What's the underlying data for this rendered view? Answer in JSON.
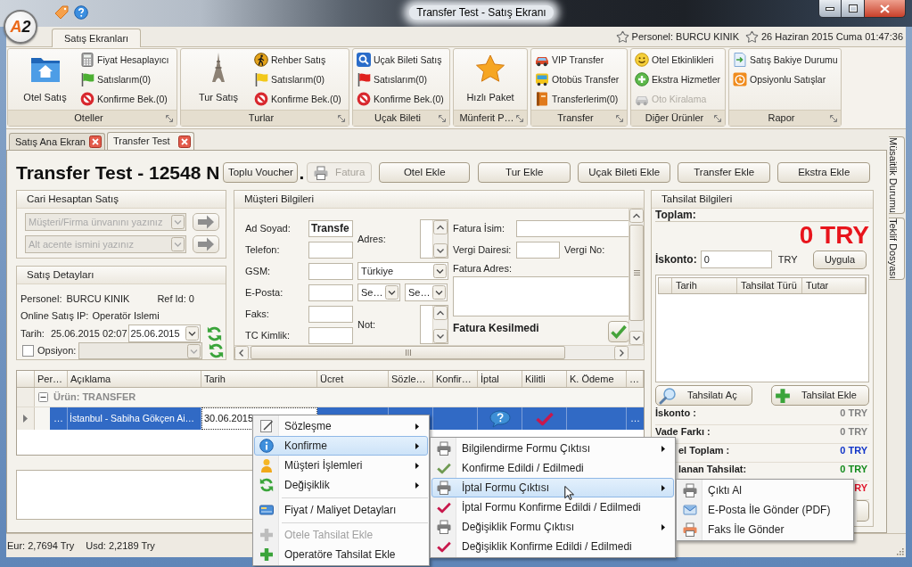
{
  "window": {
    "title": "Transfer Test - Satış Ekranı",
    "logo": "A2"
  },
  "ribbon": {
    "tabs": [
      {
        "label": "Satış Ekranları",
        "selected": true
      }
    ],
    "info": [
      {
        "text": "Personel: BURCU KINIK"
      },
      {
        "text": "26 Haziran 2015 Cuma 01:47:36"
      }
    ],
    "groups": [
      {
        "title": "Oteller",
        "large_button": "Otel Satış",
        "items": [
          {
            "label": "Fiyat Hesaplayıcı",
            "disabled": false
          },
          {
            "label": "Satıslarım(0)",
            "disabled": false
          },
          {
            "label": "Konfirme Bek.(0)",
            "disabled": false
          }
        ]
      },
      {
        "title": "Turlar",
        "large_button": "Tur Satış",
        "items": [
          {
            "label": "Rehber Satış",
            "disabled": false
          },
          {
            "label": "Satıslarım(0)",
            "disabled": false
          },
          {
            "label": "Konfirme Bek.(0)",
            "disabled": false
          }
        ]
      },
      {
        "title": "Uçak Bileti",
        "items": [
          {
            "label": "Uçak Bileti Satış",
            "disabled": false
          },
          {
            "label": "Satıslarım(0)",
            "disabled": false
          },
          {
            "label": "Konfirme Bek.(0)",
            "disabled": false
          }
        ]
      },
      {
        "title": "Münferit P…",
        "large_button": "Hızlı Paket"
      },
      {
        "title": "Transfer",
        "items": [
          {
            "label": "VIP Transfer",
            "disabled": false
          },
          {
            "label": "Otobüs Transfer",
            "disabled": false
          },
          {
            "label": "Transferlerim(0)",
            "disabled": false
          }
        ]
      },
      {
        "title": "Diğer Ürünler",
        "items": [
          {
            "label": "Otel Etkinlikleri",
            "disabled": false
          },
          {
            "label": "Ekstra Hizmetler",
            "disabled": false
          },
          {
            "label": "Oto Kiralama",
            "disabled": true
          }
        ]
      },
      {
        "title": "Rapor",
        "items": [
          {
            "label": "Satış Bakiye Durumu",
            "disabled": false
          },
          {
            "label": "Opsiyonlu Satışlar",
            "disabled": false
          }
        ]
      }
    ]
  },
  "document_tabs": [
    {
      "label": "Satış Ana Ekran",
      "selected": false
    },
    {
      "label": "Transfer Test",
      "selected": true
    }
  ],
  "side_tabs": [
    {
      "label": "Müsaitlik Durumu"
    },
    {
      "label": "Teklif Dosyası"
    }
  ],
  "header": {
    "title": "Transfer Test - 12548 N",
    "title_tail": ".",
    "buttons": [
      {
        "label": "Toplu Voucher",
        "disabled": false
      },
      {
        "label": "Fatura",
        "disabled": true
      },
      {
        "label": "Otel Ekle",
        "disabled": false
      },
      {
        "label": "Tur Ekle",
        "disabled": false
      },
      {
        "label": "Uçak Bileti Ekle",
        "disabled": false
      },
      {
        "label": "Transfer Ekle",
        "disabled": false
      },
      {
        "label": "Ekstra Ekle",
        "disabled": false
      }
    ]
  },
  "account_sale": {
    "title": "Cari Hesaptan Satış",
    "fields": [
      {
        "placeholder": "Müşteri/Firma ünvanını yazınız",
        "disabled": true
      },
      {
        "placeholder": "Alt acente ismini yazınız",
        "disabled": true
      }
    ]
  },
  "sale_details": {
    "title": "Satış Detayları",
    "staff_label": "Personel:",
    "staff": "BURCU KINIK",
    "ref_id": "Ref Id: 0",
    "ip_label": "Online Satış IP:",
    "ip": "Operatör Islemi",
    "date_label": "Tarih:",
    "date_time": "25.06.2015 02:07",
    "date_value": "25.06.2015",
    "option": {
      "label": "Opsiyon:",
      "checked": false,
      "select_disabled": true
    }
  },
  "customer": {
    "title": "Müşteri Bilgileri",
    "fields": [
      {
        "label": "Ad Soyad:",
        "value": "Transfe"
      },
      {
        "label": "Telefon:"
      },
      {
        "label": "GSM:"
      },
      {
        "label": "E-Posta:"
      },
      {
        "label": "Faks:"
      },
      {
        "label": "TC Kimlik:"
      }
    ],
    "address_label": "Adres:",
    "country": "Türkiye",
    "email_selects": [
      "Se…",
      "Se…"
    ],
    "note_label": "Not:",
    "invoice_name_label": "Fatura İsim:",
    "tax_office_label": "Vergi Dairesi:",
    "tax_no_label": "Vergi No:",
    "invoice_address_label": "Fatura Adres:",
    "invoice_status": "Fatura Kesilmedi"
  },
  "orders": {
    "columns": [
      "Per…",
      "Açıklama",
      "Tarih",
      "Ücret",
      "Sözle…",
      "Konfir…",
      "İptal",
      "Kilitli",
      "K. Ödeme",
      "…"
    ],
    "group": {
      "label": "Ürün: TRANSFER",
      "expanded": true
    },
    "rows": [
      {
        "selected": true,
        "per": "…",
        "description": "İstanbul - Sabiha Gökçen Ai…",
        "date": "30.06.2015",
        "more": "…"
      }
    ]
  },
  "payment": {
    "title": "Tahsilat Bilgileri",
    "total_label": "Toplam:",
    "total": "0 TRY",
    "discount_label": "İskonto:",
    "discount": "0",
    "currency": "TRY",
    "apply": "Uygula",
    "columns": [
      "Tarih",
      "Tahsilat Türü",
      "Tutar"
    ],
    "buttons": [
      "Tahsilatı Aç",
      "Tahsilat Ekle"
    ],
    "summary": [
      {
        "label": "İskonto :",
        "value": "0 TRY",
        "color": "#808080"
      },
      {
        "label": "Vade Farkı :",
        "value": "0 TRY",
        "color": "#808080"
      },
      {
        "label": "el Toplam :",
        "value": "0 TRY",
        "color": "#1034c8"
      },
      {
        "label": "lanan Tahsilat:",
        "value": "0 TRY",
        "color": "#128a1c"
      },
      {
        "value": "RY",
        "color": "#e0142a"
      }
    ]
  },
  "status_bar": [
    "Eur: 2,7694 Try",
    "Usd: 2,2189 Try"
  ],
  "context_menu": {
    "items": [
      {
        "kind": "item",
        "label": "Sözleşme",
        "submenu": true,
        "selected": false,
        "disabled": false
      },
      {
        "kind": "item",
        "label": "Konfirme",
        "submenu": true,
        "selected": true,
        "disabled": false
      },
      {
        "kind": "item",
        "label": "Müşteri İşlemleri",
        "submenu": true,
        "selected": false,
        "disabled": false
      },
      {
        "kind": "item",
        "label": "Değişiklik",
        "submenu": true,
        "selected": false,
        "disabled": false
      },
      {
        "kind": "separator"
      },
      {
        "kind": "item",
        "label": "Fiyat / Maliyet Detayları",
        "submenu": false,
        "selected": false,
        "disabled": false
      },
      {
        "kind": "separator"
      },
      {
        "kind": "item",
        "label": "Otele Tahsilat Ekle",
        "submenu": false,
        "selected": false,
        "disabled": true
      },
      {
        "kind": "item",
        "label": "Operatöre Tahsilat Ekle",
        "submenu": false,
        "selected": false,
        "disabled": false
      }
    ]
  },
  "submenu": {
    "items": [
      {
        "kind": "item",
        "label": "Bilgilendirme Formu Çıktısı",
        "submenu": true,
        "selected": false,
        "disabled": false
      },
      {
        "kind": "item",
        "label": "Konfirme Edildi / Edilmedi",
        "submenu": false,
        "selected": false,
        "disabled": false
      },
      {
        "kind": "item",
        "label": "İptal Formu Çıktısı",
        "submenu": true,
        "selected": true,
        "disabled": false
      },
      {
        "kind": "item",
        "label": "İptal Formu Konfirme Edildi / Edilmedi",
        "submenu": false,
        "selected": false,
        "disabled": false
      },
      {
        "kind": "item",
        "label": "Değişiklik Formu Çıktısı",
        "submenu": true,
        "selected": false,
        "disabled": false
      },
      {
        "kind": "item",
        "label": "Değişiklik Konfirme Edildi / Edilmedi",
        "submenu": false,
        "selected": false,
        "disabled": false
      }
    ]
  },
  "submenu_2": {
    "items": [
      {
        "kind": "item",
        "label": "Çıktı Al",
        "submenu": false,
        "selected": false,
        "disabled": false
      },
      {
        "kind": "item",
        "label": "E-Posta İle Gönder (PDF)",
        "submenu": false,
        "selected": false,
        "disabled": false
      },
      {
        "kind": "item",
        "label": "Faks İle Gönder",
        "submenu": false,
        "selected": false,
        "disabled": false
      }
    ]
  }
}
